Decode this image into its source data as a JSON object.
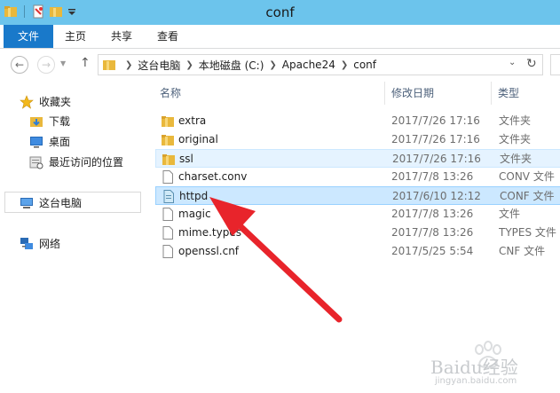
{
  "window": {
    "title": "conf"
  },
  "ribbon": {
    "tabs": [
      "文件",
      "主页",
      "共享",
      "查看"
    ]
  },
  "address": {
    "crumbs": [
      "这台电脑",
      "本地磁盘 (C:)",
      "Apache24",
      "conf"
    ]
  },
  "nav": {
    "favorites": "收藏夹",
    "downloads": "下载",
    "desktop": "桌面",
    "recent": "最近访问的位置",
    "this_pc": "这台电脑",
    "network": "网络"
  },
  "columns": {
    "name": "名称",
    "date": "修改日期",
    "type": "类型"
  },
  "files": [
    {
      "name": "extra",
      "date": "2017/7/26 17:16",
      "type": "文件夹",
      "icon": "folder-icon"
    },
    {
      "name": "original",
      "date": "2017/7/26 17:16",
      "type": "文件夹",
      "icon": "folder-icon"
    },
    {
      "name": "ssl",
      "date": "2017/7/26 17:16",
      "type": "文件夹",
      "icon": "folder-icon"
    },
    {
      "name": "charset.conv",
      "date": "2017/7/8 13:26",
      "type": "CONV 文件",
      "icon": "file-icon"
    },
    {
      "name": "httpd",
      "date": "2017/6/10 12:12",
      "type": "CONF 文件",
      "icon": "conf-file-icon"
    },
    {
      "name": "magic",
      "date": "2017/7/8 13:26",
      "type": "文件",
      "icon": "file-icon"
    },
    {
      "name": "mime.types",
      "date": "2017/7/8 13:26",
      "type": "TYPES 文件",
      "icon": "file-icon"
    },
    {
      "name": "openssl.cnf",
      "date": "2017/5/25 5:54",
      "type": "CNF 文件",
      "icon": "file-icon"
    }
  ],
  "colors": {
    "titlebar": "#6cc4ec",
    "file_tab": "#1979ca",
    "selection": "#cce8ff",
    "arrow": "#e8242b"
  },
  "watermark": {
    "text": "Baidu经验",
    "url": "jingyan.baidu.com"
  }
}
